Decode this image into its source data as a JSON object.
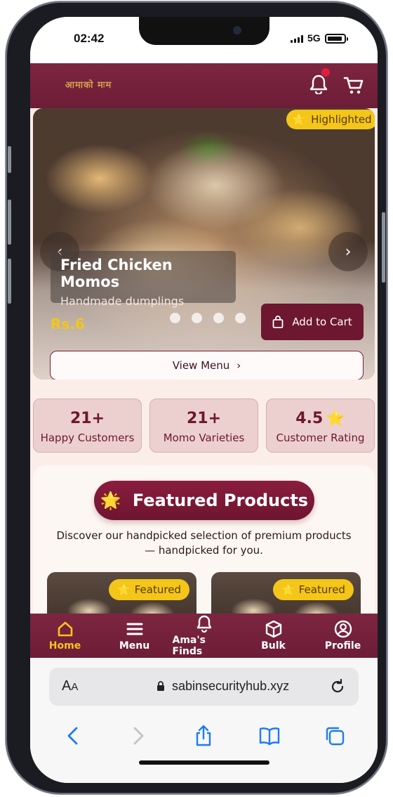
{
  "status_bar": {
    "time": "02:42",
    "network": "5G"
  },
  "header": {
    "logo_text": "आमाको मःम"
  },
  "hero": {
    "badge": "Highlighted",
    "title": "Fried Chicken Momos",
    "subtitle": "Handmade dumplings",
    "price": "Rs.6",
    "add_to_cart": "Add to Cart",
    "view_menu": "View Menu",
    "carousel_dots": 4
  },
  "stats": [
    {
      "value": "21+",
      "label": "Happy Customers"
    },
    {
      "value": "21+",
      "label": "Momo Varieties"
    },
    {
      "value": "4.5",
      "label": "Customer Rating"
    }
  ],
  "featured": {
    "title": "Featured Products",
    "description": "Discover our handpicked selection of premium products — handpicked for you.",
    "cards": [
      {
        "badge": "Featured"
      },
      {
        "badge": "Featured"
      }
    ]
  },
  "bottom_nav": [
    {
      "label": "Home",
      "icon": "home-icon",
      "active": true
    },
    {
      "label": "Menu",
      "icon": "menu-icon",
      "active": false
    },
    {
      "label": "Ama's Finds",
      "icon": "bell-icon",
      "active": false
    },
    {
      "label": "Bulk",
      "icon": "box-icon",
      "active": false
    },
    {
      "label": "Profile",
      "icon": "user-icon",
      "active": false
    }
  ],
  "browser": {
    "text_size": "AA",
    "url": "sabinsecurityhub.xyz"
  },
  "colors": {
    "brand": "#6d1d37",
    "accent": "#f3c619",
    "background": "#fbeee8"
  }
}
